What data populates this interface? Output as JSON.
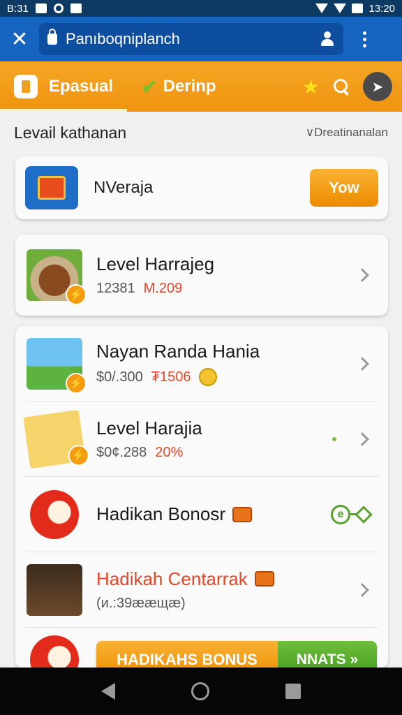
{
  "status_bar": {
    "left_text": "B:31",
    "time": "13:20"
  },
  "browser": {
    "url": "Panıboqniplanch"
  },
  "tabs": [
    {
      "label": "Epasual",
      "active": true
    },
    {
      "label": "Derinp",
      "active": false
    }
  ],
  "section": {
    "title": "Levail kathanan",
    "link": "∨Dreatinanalan"
  },
  "promo": {
    "name": "NVerajа",
    "button": "Yow"
  },
  "level_item": {
    "title": "Level Harrajeg",
    "sub_a": "12381",
    "sub_b": "M.209"
  },
  "items": [
    {
      "title": "Nayan Randa Hania",
      "sub_a": "$0/.300",
      "sub_b": "₮1506"
    },
    {
      "title": "Level Harajia",
      "sub_a": "$0¢.288",
      "sub_b": "20%"
    },
    {
      "title": "Hadikan Bonosr"
    },
    {
      "title": "Hadikah Centarrak",
      "sub_a": "(и.:39ææщæ)"
    }
  ],
  "bonus": {
    "label": "HADIKAHS BONUS",
    "action": "NNATS »"
  },
  "colors": {
    "accent_orange": "#f5a623",
    "brand_blue": "#1565c0",
    "accent_green": "#5aa02c",
    "accent_red": "#e2482a"
  }
}
